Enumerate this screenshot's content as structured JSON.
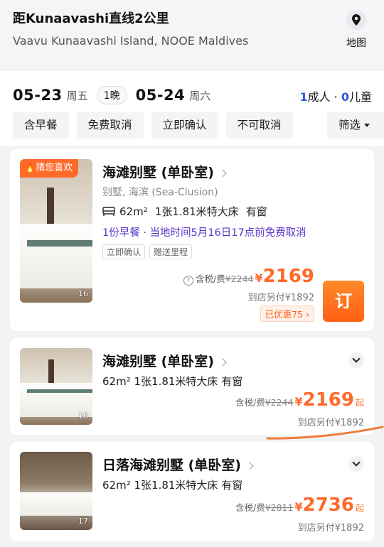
{
  "header": {
    "distance": "距Kunaavashi直线2公里",
    "address": "Vaavu Kunaavashi Island, NOOE Maldives",
    "map_label": "地图"
  },
  "dates": {
    "checkin": "05-23",
    "checkin_weekday": "周五",
    "nights": "1晚",
    "checkout": "05-24",
    "checkout_weekday": "周六",
    "adults_num": "1",
    "adults_label": "成人 · ",
    "children_num": "0",
    "children_label": "儿童"
  },
  "filters": [
    "含早餐",
    "免费取消",
    "立即确认",
    "不可取消"
  ],
  "filter_more": "筛选",
  "rooms": [
    {
      "tag": "猜您喜欢",
      "name": "海滩别墅 (单卧室)",
      "category": "别墅, 海滨 (Sea-Clusion)",
      "area": "62m²",
      "bed": "1张1.81米特大床",
      "window": "有窗",
      "policy": "1份早餐 · 当地时间5月16日17点前免费取消",
      "badges": [
        "立即确认",
        "赠送里程"
      ],
      "tax_label": "含税/费",
      "original_price": "¥2244",
      "currency": "¥",
      "price": "2169",
      "arrive_pay": "到店另付¥1892",
      "discount": "已优惠75 ›",
      "book_label": "订",
      "photo_count": "16"
    },
    {
      "name": "海滩别墅 (单卧室)",
      "specs": "62m² 1张1.81米特大床 有窗",
      "tax_label": "含税/费",
      "original_price": "¥2244",
      "currency": "¥",
      "price": "2169",
      "from": "起",
      "arrive_pay": "到店另付¥1892",
      "photo_count": "16"
    },
    {
      "name": "日落海滩别墅 (单卧室)",
      "specs": "62m² 1张1.81米特大床 有窗",
      "tax_label": "含税/费",
      "original_price": "¥2811",
      "currency": "¥",
      "price": "2736",
      "from": "起",
      "arrive_pay": "到店另付¥1892",
      "photo_count": "17"
    }
  ],
  "colors": {
    "accent_orange": "#ff6a2b",
    "policy_purple": "#5a34c9",
    "guest_blue": "#2a5bd7"
  }
}
